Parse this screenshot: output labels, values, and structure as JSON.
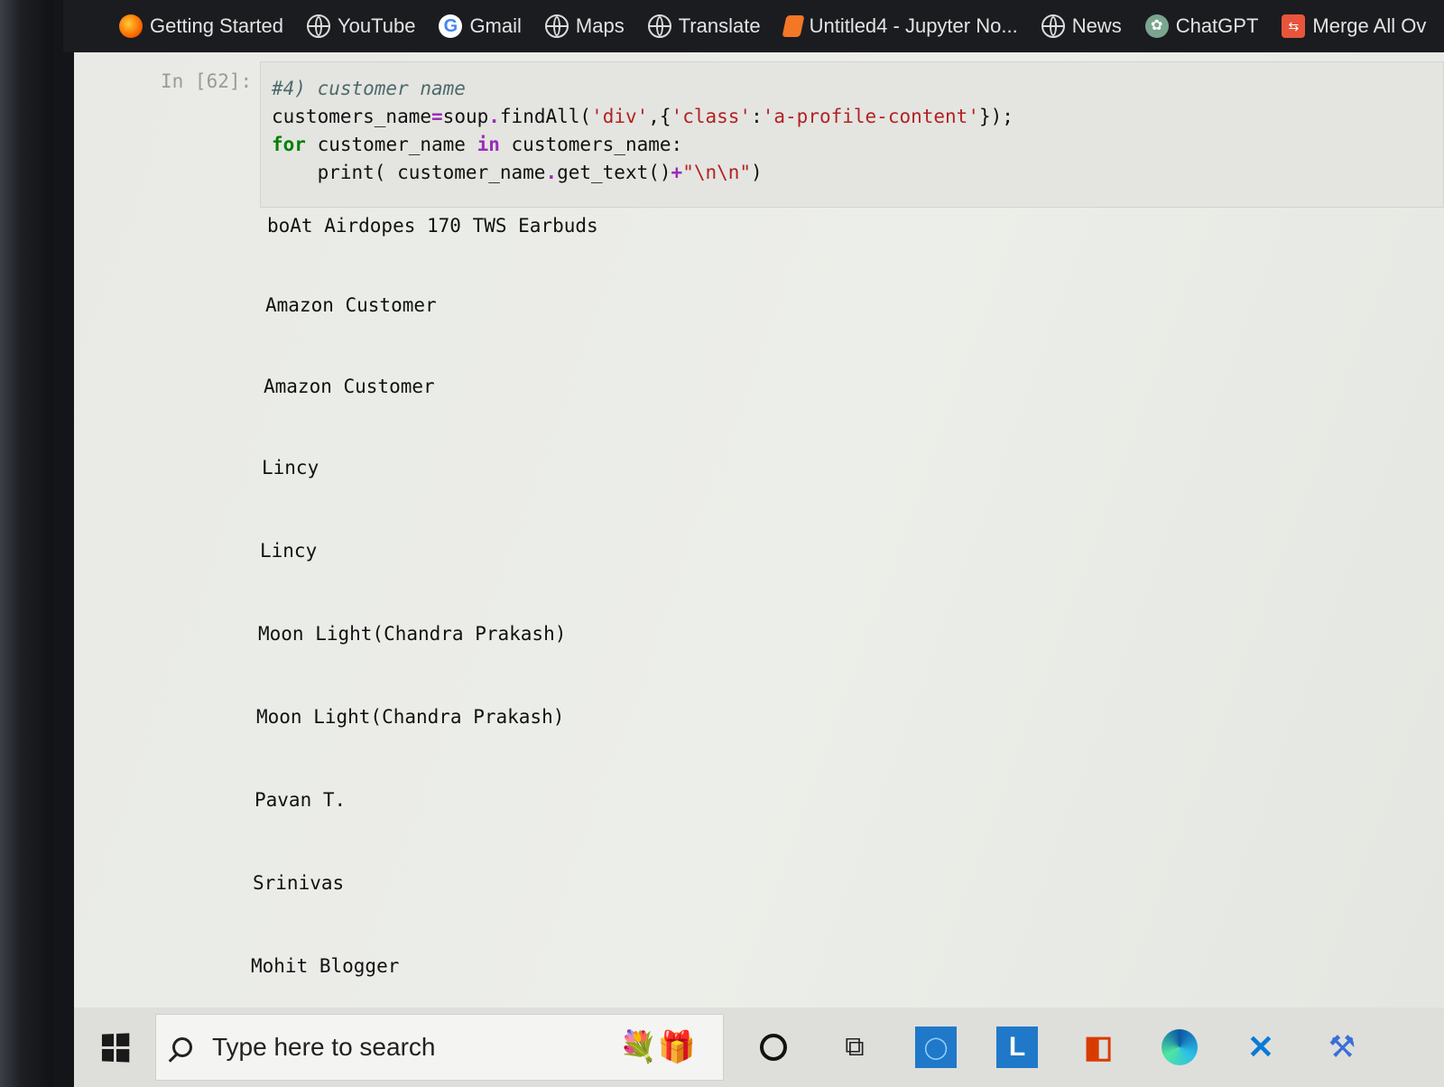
{
  "bookmarks": [
    {
      "label": "Getting Started",
      "icon": "firefox-icon"
    },
    {
      "label": "YouTube",
      "icon": "globe-icon"
    },
    {
      "label": "Gmail",
      "icon": "google-icon"
    },
    {
      "label": "Maps",
      "icon": "globe-icon"
    },
    {
      "label": "Translate",
      "icon": "globe-icon"
    },
    {
      "label": "Untitled4 - Jupyter No...",
      "icon": "jupyter-icon"
    },
    {
      "label": "News",
      "icon": "globe-icon"
    },
    {
      "label": "ChatGPT",
      "icon": "chatgpt-icon"
    },
    {
      "label": "Merge All Ov",
      "icon": "merge-icon"
    }
  ],
  "cell": {
    "prompt": "In [62]:",
    "code": {
      "line1_comment": "#4) customer name",
      "line2_a": "customers_name",
      "line2_eq": "=",
      "line2_b": "soup",
      "line2_dot": ".",
      "line2_c": "findAll(",
      "line2_s1": "'div'",
      "line2_d": ",{",
      "line2_s2": "'class'",
      "line2_e": ":",
      "line2_s3": "'a-profile-content'",
      "line2_f": "});",
      "line3_for": "for",
      "line3_a": " customer_name ",
      "line3_in": "in",
      "line3_b": " customers_name:",
      "line4_a": "    print( customer_name",
      "line4_dot": ".",
      "line4_b": "get_text()",
      "line4_plus": "+",
      "line4_s": "\"\\n\\n\"",
      "line4_c": ")"
    },
    "output": [
      "boAt Airdopes 170 TWS Earbuds",
      "Amazon Customer",
      "Amazon Customer",
      "Lincy",
      "Lincy",
      "Moon Light(Chandra Prakash)",
      "Moon Light(Chandra Prakash)",
      "Pavan T.",
      "Srinivas",
      "Mohit Blogger"
    ]
  },
  "taskbar": {
    "search_placeholder": "Type here to search"
  }
}
